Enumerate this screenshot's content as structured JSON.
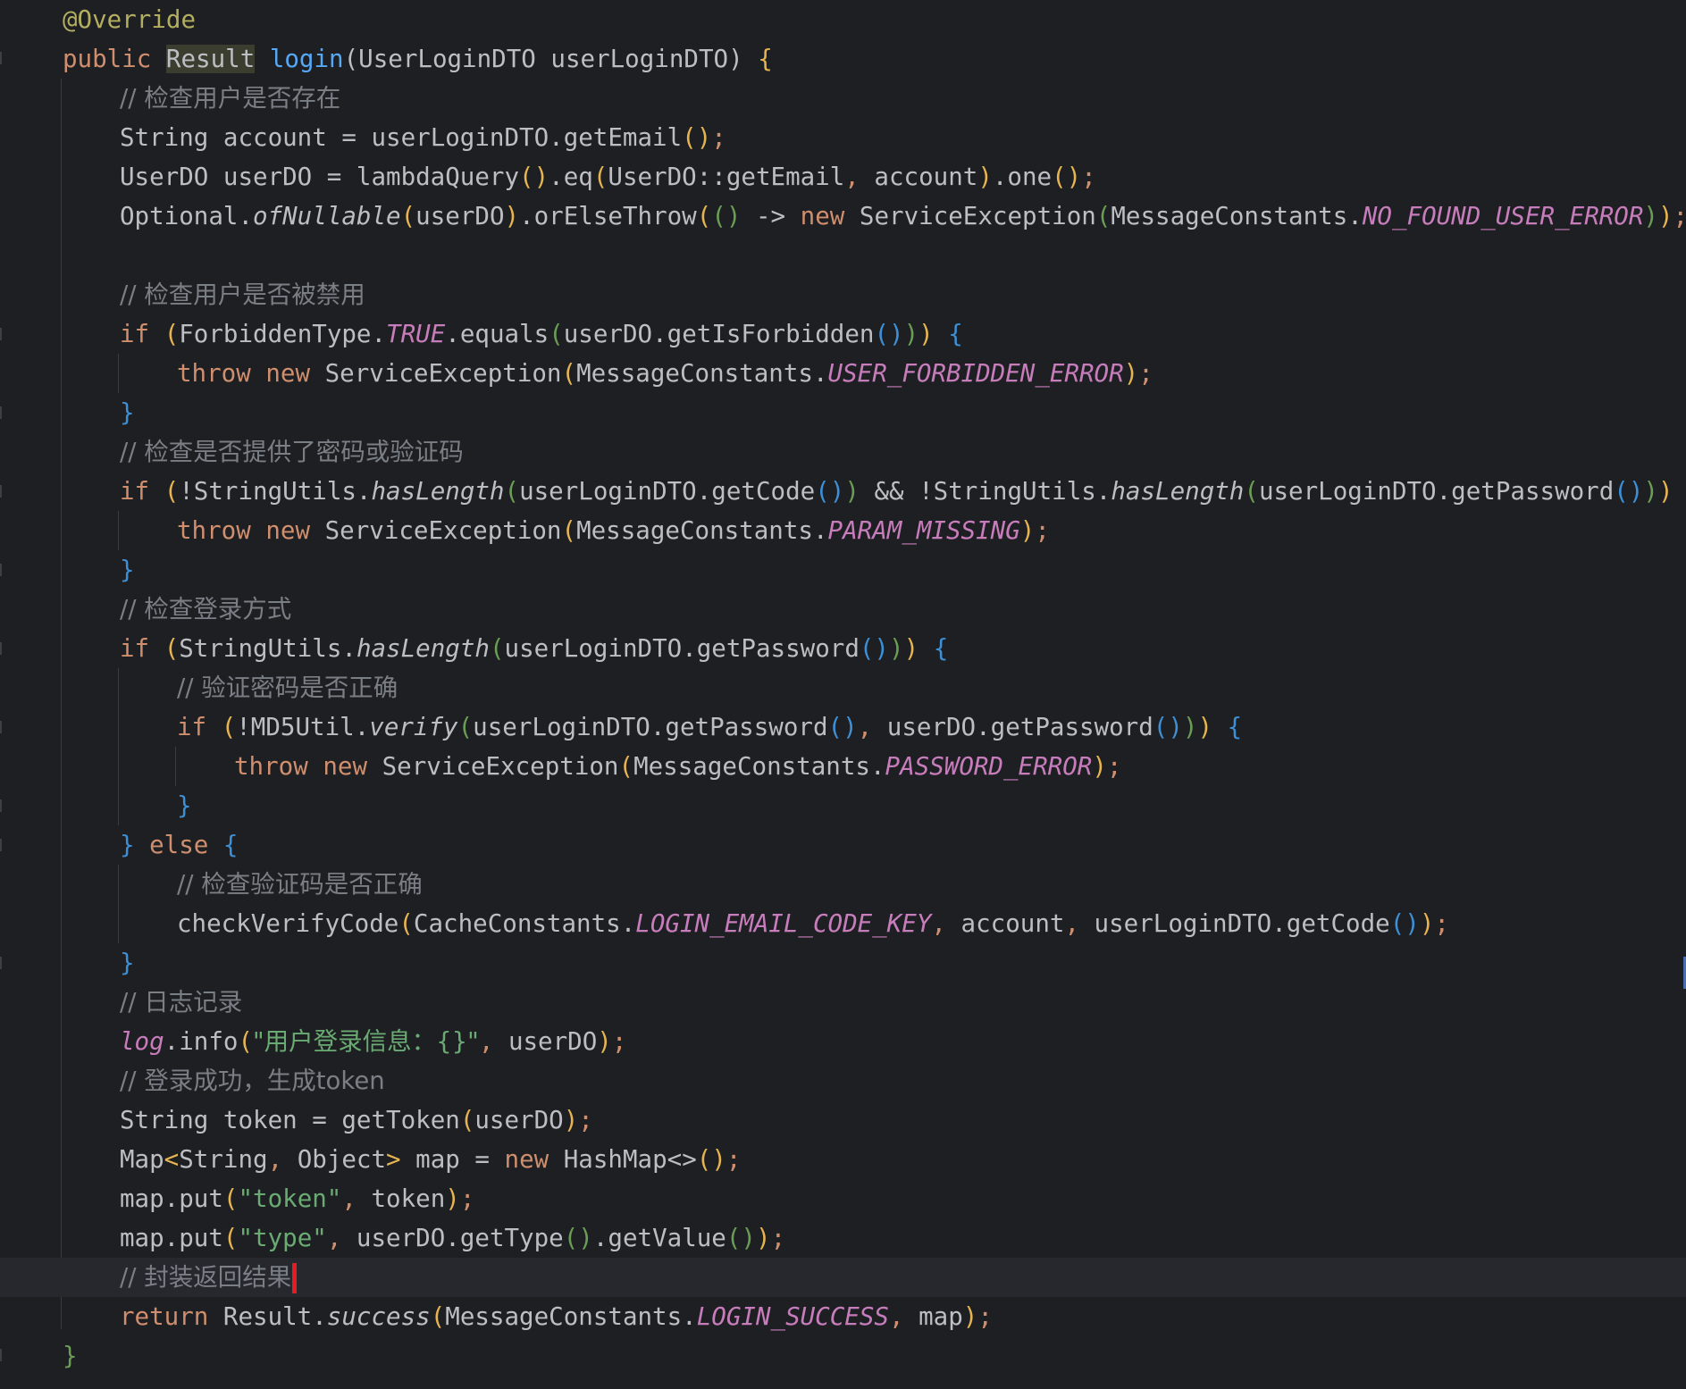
{
  "editor": {
    "accent_colors": {
      "background": "#1e1f22",
      "keyword": "#cf8e6d",
      "annotation": "#b3ae60",
      "method_declaration": "#56a8f5",
      "comment": "#7a7e85",
      "constant": "#c77dbb",
      "string": "#6aab73",
      "caret": "#e51c23"
    },
    "tokens": {
      "override": "@Override",
      "public": "public",
      "result_type": "Result",
      "login": "login",
      "params": "(UserLoginDTO userLoginDTO) ",
      "open_brace": "{",
      "close_brace": "}",
      "cm_check_user_exists": "// 检查用户是否存在",
      "string_kw": "String",
      "account_decl": " account = userLoginDTO.getEmail",
      "userdo_decl": "UserDO userDO = lambdaQuery",
      "eq_call": ".eq",
      "eq_args": "UserDO::getEmail",
      "account_arg": " account",
      "one_call": ".one",
      "optional": "Optional.",
      "of_nullable": "ofNullable",
      "userdo": "userDO",
      "or_else_throw": ".orElseThrow",
      "lambda_arrow": " -> ",
      "new": "new",
      "service_exception": " ServiceException",
      "message_constants": "MessageConstants.",
      "no_found_user_error": "NO_FOUND_USER_ERROR",
      "cm_check_forbidden": "// 检查用户是否被禁用",
      "if": "if",
      "forbidden_type": "ForbiddenType.",
      "true_const": "TRUE",
      "equals_call": ".equals",
      "get_is_forbidden": "userDO.getIsForbidden",
      "throw": "throw",
      "user_forbidden_error": "USER_FORBIDDEN_ERROR",
      "cm_check_password_or_code": "// 检查是否提供了密码或验证码",
      "not_string_utils": "!StringUtils.",
      "has_length": "hasLength",
      "get_code": "userLoginDTO.getCode",
      "and_op": " && ",
      "get_password": "userLoginDTO.getPassword",
      "param_missing": "PARAM_MISSING",
      "cm_check_login_type": "// 检查登录方式",
      "string_utils": "StringUtils.",
      "cm_verify_password": "// 验证密码是否正确",
      "not_md5util": "!MD5Util.",
      "verify": "verify",
      "userdo_get_password": " userDO.getPassword",
      "password_error": "PASSWORD_ERROR",
      "else": "else",
      "cm_check_verify_code": "// 检查验证码是否正确",
      "check_verify_code": "checkVerifyCode",
      "cache_constants": "CacheConstants.",
      "login_email_code_key": "LOGIN_EMAIL_CODE_KEY",
      "get_code_arg": " userLoginDTO.getCode",
      "cm_log": "// 日志记录",
      "log": "log",
      "info_call": ".info",
      "log_msg": "\"用户登录信息：{}\"",
      "userdo_arg": " userDO",
      "cm_login_success": "// 登录成功，生成token",
      "token_decl": " token = getToken",
      "map_type": "Map",
      "lt": "<",
      "gt": ">",
      "string_generic": "String",
      "object_generic": " Object",
      "map_decl": " map = ",
      "hashmap": " HashMap",
      "diamond": "<>",
      "map_put": "map.put",
      "token_key": "\"token\"",
      "token_arg": " token",
      "type_key": "\"type\"",
      "get_type": " userDO.getType",
      "get_value": ".getValue",
      "cm_wrap_result": "// 封装返回结果",
      "return": "return",
      "result_success": " Result.",
      "success": "success",
      "login_success": "LOGIN_SUCCESS",
      "map_arg": " map",
      "semicolon": ";",
      "comma": ",",
      "lparen": "(",
      "rparen": ")",
      "empty_parens": "()",
      "space": " "
    }
  }
}
